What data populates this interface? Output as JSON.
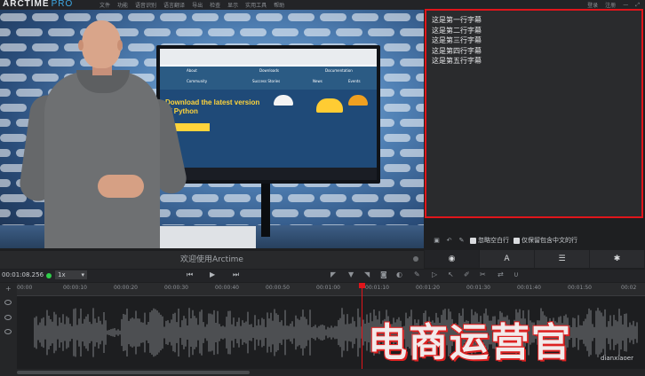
{
  "app": {
    "logo_main": "ARCTIME",
    "logo_sub": "PRO",
    "menu": [
      "文件",
      "功能",
      "语音识别",
      "语言翻译",
      "导出",
      "检查",
      "显示",
      "实用工具",
      "帮助"
    ],
    "login": "登录",
    "register": "注册"
  },
  "subtitles": {
    "lines": [
      "这是第一行字幕",
      "这是第二行字幕",
      "这是第三行字幕",
      "这是第四行字幕",
      "这是第五行字幕"
    ]
  },
  "options": {
    "ignore_empty_label": "忽略空白行",
    "keep_chinese_label": "仅保留包含中文的行"
  },
  "tabs": [
    {
      "icon": "speech-bubble-icon",
      "label": "◉"
    },
    {
      "icon": "font-icon",
      "label": "A"
    },
    {
      "icon": "list-icon",
      "label": "☰"
    },
    {
      "icon": "gear-icon",
      "label": "✱"
    }
  ],
  "welcome": "欢迎使用Arctime",
  "transport": {
    "timecode": "00:01:08.256",
    "speed": "1x"
  },
  "ruler": {
    "ticks": [
      "00:00",
      "00:00:10",
      "00:00:20",
      "00:00:30",
      "00:00:40",
      "00:00:50",
      "00:01:00",
      "00:01:10",
      "00:01:20",
      "00:01:30",
      "00:01:40",
      "00:01:50",
      "00:02"
    ]
  },
  "video": {
    "monitor_nav": [
      "About",
      "Downloads",
      "Documentation",
      "Community",
      "Success Stories",
      "News",
      "Events"
    ],
    "headline": "Download the latest version of Python"
  },
  "watermark": {
    "text": "电商运营官",
    "sub": "dianxiaoer"
  },
  "colors": {
    "accent": "#3da9e6",
    "highlight_border": "#e0151b",
    "record_green": "#2fcf4a",
    "playhead": "#e0151b"
  }
}
